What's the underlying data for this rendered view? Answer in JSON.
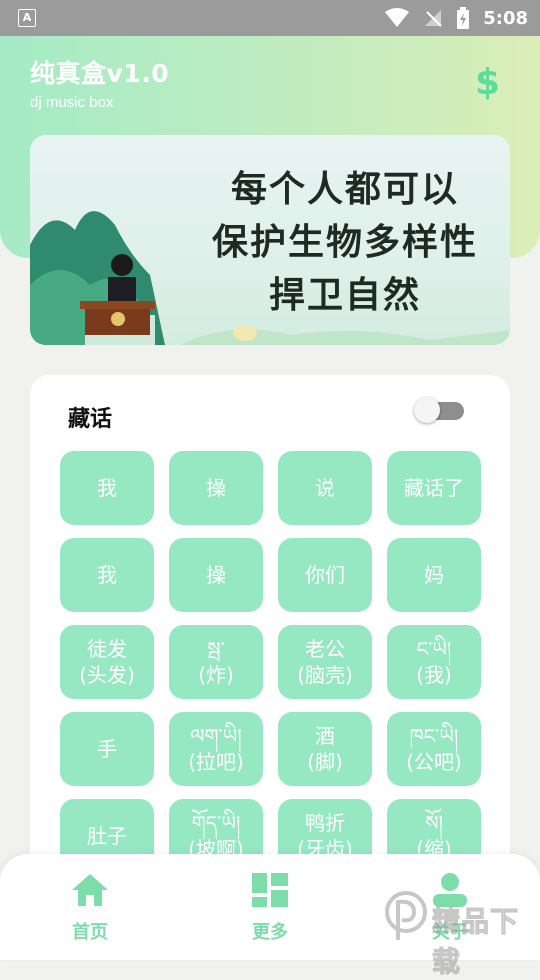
{
  "status_bar": {
    "time": "5:08"
  },
  "header": {
    "title": "纯真盒v1.0",
    "subtitle": "dj music box",
    "icon": "dollar-icon"
  },
  "banner": {
    "text": "每个人都可以\n保护生物多样性\n捍卫自然"
  },
  "card": {
    "title": "藏话",
    "toggle_on": false,
    "buttons": [
      {
        "label": "我"
      },
      {
        "label": "操"
      },
      {
        "label": "说"
      },
      {
        "label": "藏话了"
      },
      {
        "label": "我"
      },
      {
        "label": "操"
      },
      {
        "label": "你们"
      },
      {
        "label": "妈"
      },
      {
        "label": "徒发\n(头发)"
      },
      {
        "label": "སྦ་\n(炸)"
      },
      {
        "label": "老公\n(脑壳)"
      },
      {
        "label": "ང་ཡི།\n(我)"
      },
      {
        "label": "手"
      },
      {
        "label": "ལག་ཡི།\n(拉吧)"
      },
      {
        "label": "酒\n(脚)"
      },
      {
        "label": "ཁང་ཡི།\n(公吧)"
      },
      {
        "label": "肚子"
      },
      {
        "label": "གོད་ཡི།\n(坡啊)"
      },
      {
        "label": "鸭折\n(牙齿)"
      },
      {
        "label": "སོ།\n(缩)"
      }
    ]
  },
  "bottom_nav": [
    {
      "label": "首页",
      "icon": "home-icon"
    },
    {
      "label": "更多",
      "icon": "grid-icon"
    },
    {
      "label": "关于",
      "icon": "user-icon"
    }
  ],
  "watermark": "精品下载",
  "colors": {
    "accent": "#96e8c3",
    "nav": "#7cdcaa",
    "header_start": "#a4ebc6",
    "header_end": "#dbeeb7"
  }
}
